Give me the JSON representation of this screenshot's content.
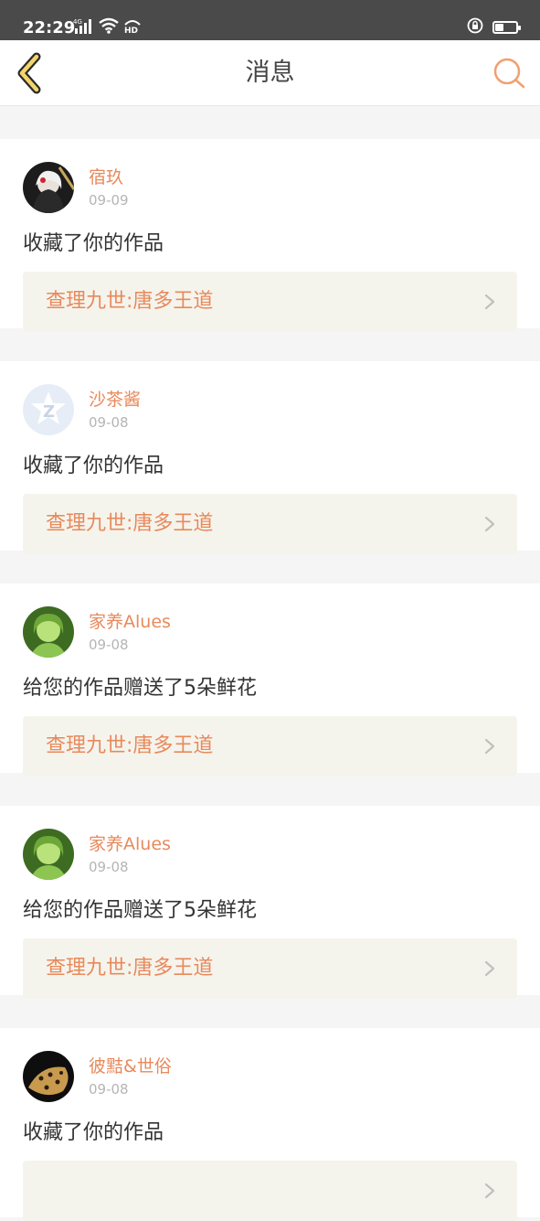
{
  "status_bar": {
    "time": "22:29",
    "network": "4G",
    "hd": "HD",
    "battery_level": 0.4
  },
  "header": {
    "title": "消息",
    "back_icon": "chevron-left-icon",
    "search_icon": "search-icon",
    "accent_color": "#e8895c"
  },
  "messages": [
    {
      "user": "宿玖",
      "date": "09-09",
      "action": "收藏了你的作品",
      "work": "查理九世:唐多王道"
    },
    {
      "user": "沙茶酱",
      "date": "09-08",
      "action": "收藏了你的作品",
      "work": "查理九世:唐多王道"
    },
    {
      "user": "家养Alues",
      "date": "09-08",
      "action": "给您的作品赠送了5朵鲜花",
      "work": "查理九世:唐多王道"
    },
    {
      "user": "家养Alues",
      "date": "09-08",
      "action": "给您的作品赠送了5朵鲜花",
      "work": "查理九世:唐多王道"
    },
    {
      "user": "彼黠&世俗",
      "date": "09-08",
      "action": "收藏了你的作品",
      "work": ""
    }
  ]
}
